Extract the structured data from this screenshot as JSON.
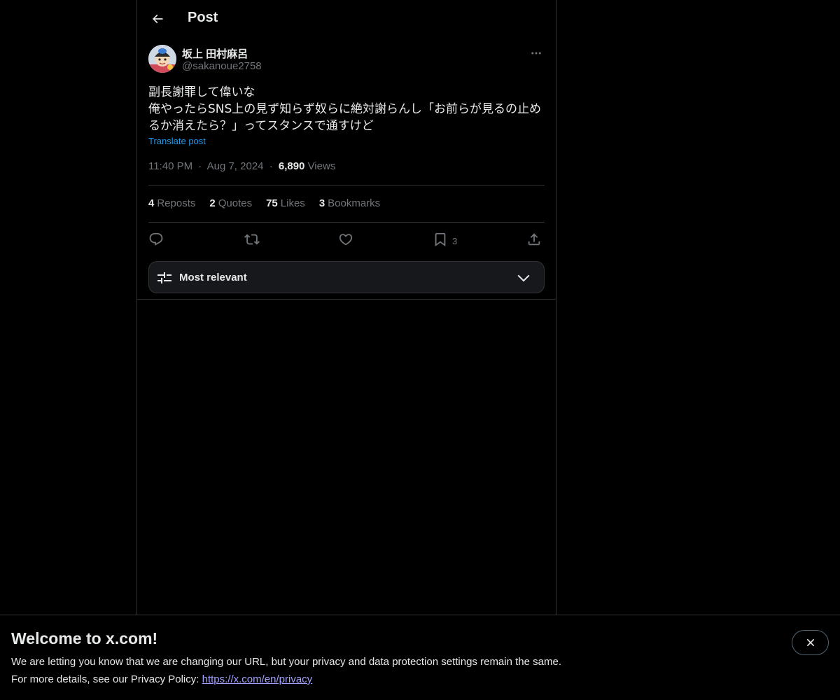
{
  "header": {
    "title": "Post"
  },
  "post": {
    "author": {
      "display_name": "坂上 田村麻呂",
      "handle": "@sakanoue2758"
    },
    "text": "副長謝罪して偉いな\n俺やったらSNS上の見ず知らず奴らに絶対謝らんし「お前らが見るの止めるか消えたら？」ってスタンスで通すけど",
    "translate_label": "Translate post",
    "time": "11:40 PM",
    "separator": "·",
    "date": "Aug 7, 2024",
    "views_count": "6,890",
    "views_label": "Views",
    "stats": {
      "reposts_count": "4",
      "reposts_label": "Reposts",
      "quotes_count": "2",
      "quotes_label": "Quotes",
      "likes_count": "75",
      "likes_label": "Likes",
      "bookmarks_count": "3",
      "bookmarks_label": "Bookmarks"
    },
    "actions": {
      "bookmark_count": "3"
    }
  },
  "sort": {
    "label": "Most relevant"
  },
  "banner": {
    "title": "Welcome to x.com!",
    "line1": "We are letting you know that we are changing our URL, but your privacy and data protection settings remain the same.",
    "line2_prefix": "For more details, see our Privacy Policy:",
    "link": "https://x.com/en/privacy"
  },
  "icons": {
    "back": "arrow-left-icon",
    "more": "more-horizontal-icon",
    "reply": "reply-icon",
    "repost": "repost-icon",
    "like": "heart-icon",
    "bookmark": "bookmark-icon",
    "share": "share-icon",
    "sort": "sliders-icon",
    "chevron": "chevron-down-icon",
    "close": "close-icon"
  },
  "colors": {
    "background": "#000000",
    "text": "#e7e9ea",
    "muted": "#71767b",
    "accent": "#1d9bf0",
    "border": "#2f3336"
  }
}
